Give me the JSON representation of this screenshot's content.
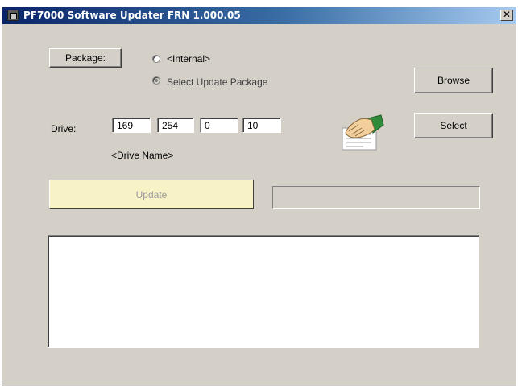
{
  "window": {
    "title": "PF7000 Software Updater FRN 1.000.05",
    "close_glyph": "✕"
  },
  "package": {
    "button_label": "Package:",
    "radio_internal": "<Internal>",
    "radio_select": "Select Update Package",
    "selected": "Select Update Package"
  },
  "browse_label": "Browse",
  "drive": {
    "label": "Drive:",
    "ip": [
      "169",
      "254",
      "0",
      "10"
    ],
    "name": "<Drive Name>"
  },
  "select_label": "Select",
  "update_label": "Update",
  "progress": {
    "value": 0
  },
  "log_text": "",
  "icons": {
    "title": "app-icon",
    "pointer": "hand-document-icon"
  },
  "colors": {
    "titlebar": "#0a246a",
    "update_button": "#f7f3c6",
    "panel": "#d4d0c8"
  }
}
